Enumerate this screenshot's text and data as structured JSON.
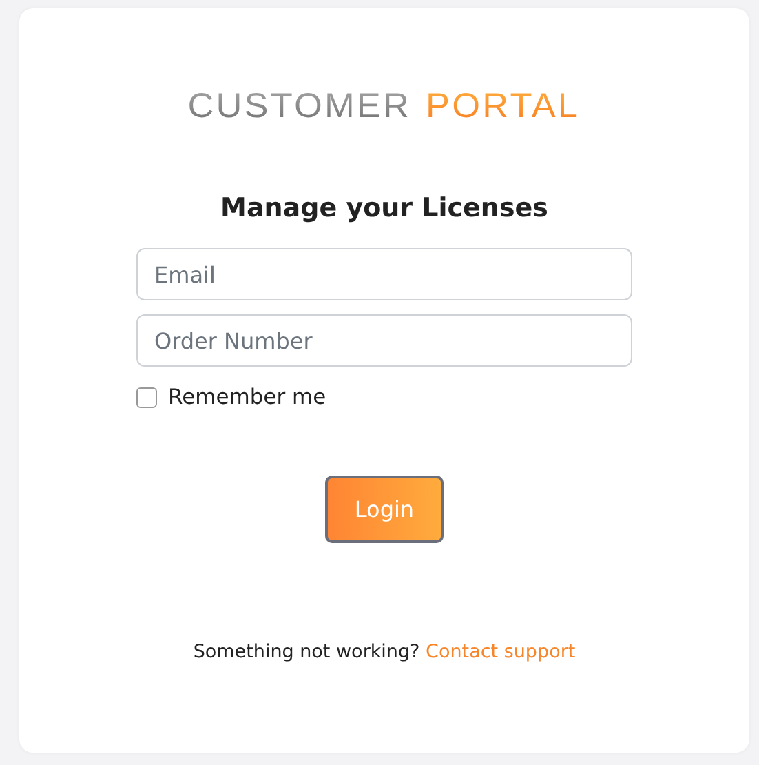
{
  "logo": {
    "first": "CUSTOMER",
    "second": "PORTAL"
  },
  "heading": "Manage your Licenses",
  "fields": [
    {
      "placeholder": "Email"
    },
    {
      "placeholder": "Order Number"
    }
  ],
  "remember": {
    "label": "Remember me",
    "checked": false
  },
  "button": "Login",
  "footer": {
    "text": "Something not working?",
    "link": "Contact support"
  }
}
